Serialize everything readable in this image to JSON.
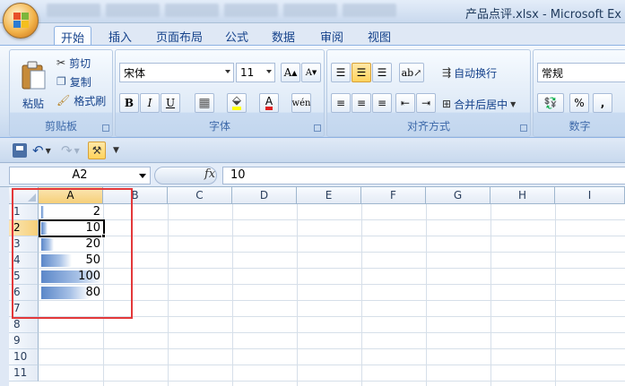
{
  "window": {
    "title": "产品点评.xlsx - Microsoft Ex"
  },
  "ribbon_tabs": [
    "开始",
    "插入",
    "页面布局",
    "公式",
    "数据",
    "审阅",
    "视图"
  ],
  "clipboard": {
    "paste": "粘贴",
    "cut": "剪切",
    "copy": "复制",
    "format_painter": "格式刷",
    "group": "剪贴板"
  },
  "font": {
    "name": "宋体",
    "size": "11",
    "bold": "B",
    "italic": "I",
    "underline": "U",
    "group": "字体"
  },
  "alignment": {
    "wrap": "自动换行",
    "merge": "合并后居中",
    "group": "对齐方式"
  },
  "number": {
    "format": "常规",
    "percent": "%",
    "comma": ",",
    "group": "数字"
  },
  "formula_bar": {
    "name_box": "A2",
    "fx": "fx",
    "value": "10"
  },
  "grid": {
    "columns": [
      "A",
      "B",
      "C",
      "D",
      "E",
      "F",
      "G",
      "H",
      "I"
    ],
    "rows": [
      "1",
      "2",
      "3",
      "4",
      "5",
      "6",
      "7",
      "8",
      "9",
      "10",
      "11"
    ],
    "selected_column": "A",
    "selected_row": "2",
    "column_a_values": [
      "2",
      "10",
      "20",
      "50",
      "100",
      "80"
    ],
    "data_bar_fractions": [
      0.02,
      0.1,
      0.2,
      0.5,
      1.0,
      0.8
    ]
  },
  "colors": {
    "data_bar": "#5b87c9",
    "highlight_frame": "#e3383a",
    "selection_header": "#f6cf79"
  }
}
